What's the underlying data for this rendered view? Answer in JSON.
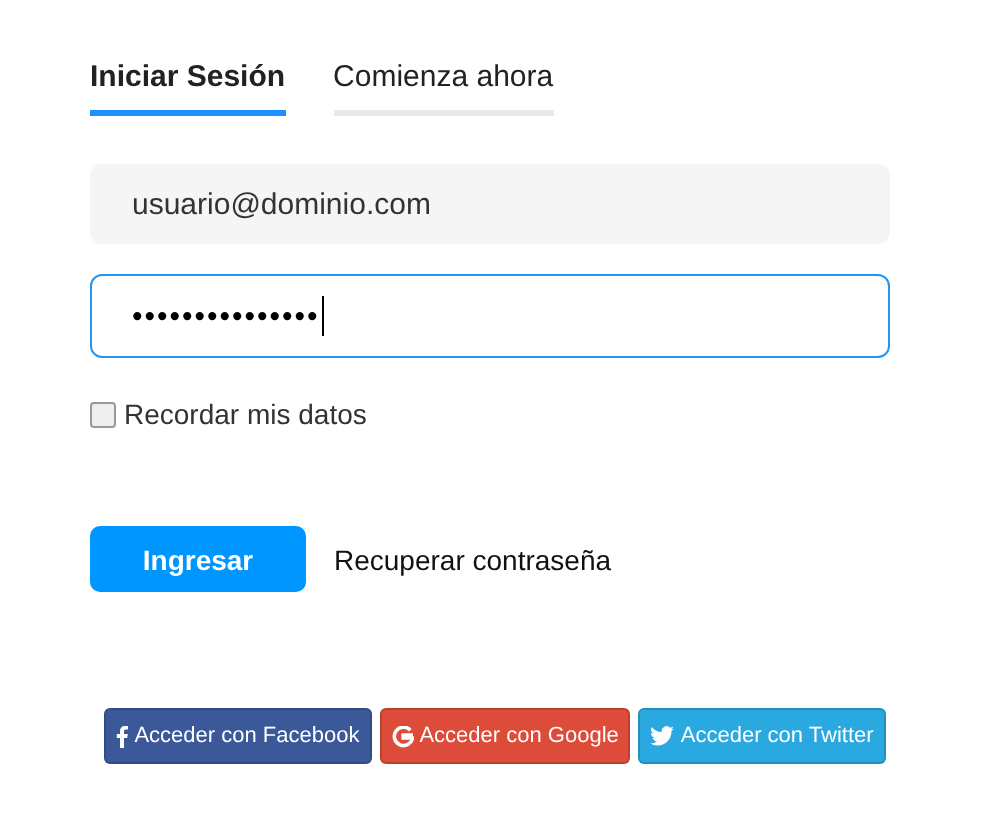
{
  "tabs": [
    {
      "label": "Iniciar Sesión",
      "selected": true
    },
    {
      "label": "Comienza ahora",
      "selected": false
    }
  ],
  "email": {
    "value": "usuario@dominio.com",
    "focused": false
  },
  "password": {
    "value": "•••••••••••••••",
    "focused": true
  },
  "remember": {
    "label": "Recordar mis datos",
    "checked": false
  },
  "submit": "Ingresar",
  "recover_link": "Recuperar contraseña",
  "social": [
    {
      "kind": "facebook",
      "label": "Acceder con Facebook",
      "color": "#3b5998"
    },
    {
      "kind": "google",
      "label": "Acceder con Google",
      "color": "#dd4b39"
    },
    {
      "kind": "twitter",
      "label": "Acceder con Twitter",
      "color": "#2aa8e0"
    }
  ]
}
